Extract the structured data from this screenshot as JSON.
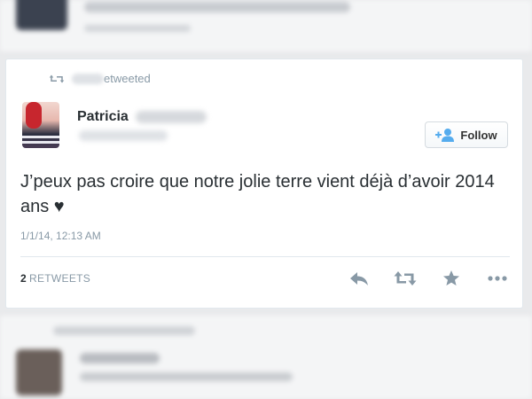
{
  "retweet_header": {
    "text": "etweeted"
  },
  "author": {
    "display_name": "Patricia"
  },
  "follow_button": {
    "label": "Follow"
  },
  "tweet": {
    "text": "J’peux pas croire que notre jolie terre vient déjà d’avoir 2014 ans ♥",
    "timestamp": "1/1/14, 12:13 AM"
  },
  "stats": {
    "retweet_count": "2",
    "retweet_label": "RETWEETS"
  },
  "actions": [
    {
      "icon": "reply-icon"
    },
    {
      "icon": "retweet-icon"
    },
    {
      "icon": "favorite-star-icon"
    },
    {
      "icon": "more-dots-icon"
    }
  ],
  "colors": {
    "text": "#292f33",
    "muted": "#8899a6",
    "accent": "#55acee",
    "border": "#e1e8ed"
  }
}
